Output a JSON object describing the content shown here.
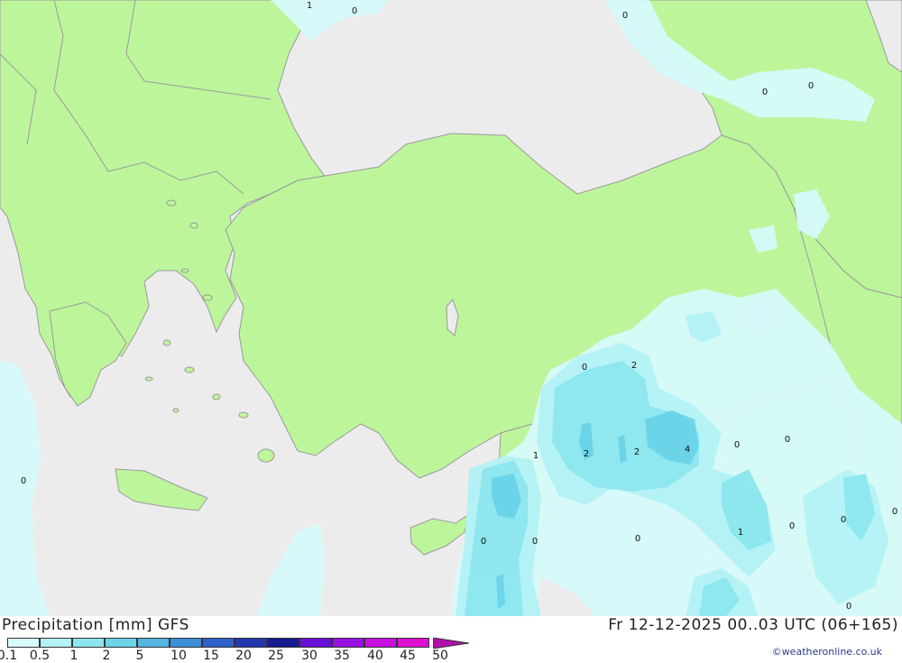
{
  "title": "Precipitation [mm] GFS",
  "datetime": "Fr 12-12-2025 00..03 UTC (06+165)",
  "credit": "©weatheronline.co.uk",
  "colors": {
    "sea": "#ececec",
    "land": "#bdf59b",
    "border": "#9a9a9a"
  },
  "legend": [
    {
      "label": "0.1",
      "color": "#d7fafa"
    },
    {
      "label": "0.5",
      "color": "#b3f2f5"
    },
    {
      "label": "1",
      "color": "#8de6ee"
    },
    {
      "label": "2",
      "color": "#6bd4e8"
    },
    {
      "label": "5",
      "color": "#55b4e0"
    },
    {
      "label": "10",
      "color": "#3e8ed8"
    },
    {
      "label": "15",
      "color": "#2f62cc"
    },
    {
      "label": "20",
      "color": "#2438b0"
    },
    {
      "label": "25",
      "color": "#181a90"
    },
    {
      "label": "30",
      "color": "#6a10d8"
    },
    {
      "label": "35",
      "color": "#9a10e0"
    },
    {
      "label": "40",
      "color": "#c810e0"
    },
    {
      "label": "45",
      "color": "#e010d0"
    },
    {
      "label": "50",
      "color": "#b010a8"
    }
  ],
  "map_labels": [
    "1",
    "0",
    "0",
    "0",
    "0",
    "0",
    "2",
    "2",
    "2",
    "4",
    "1",
    "0",
    "0",
    "0",
    "0",
    "1",
    "0",
    "0",
    "0",
    "0",
    "0",
    "0"
  ]
}
